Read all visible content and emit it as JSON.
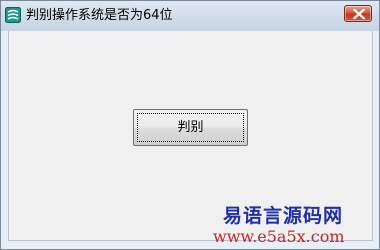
{
  "window": {
    "title": "判别操作系统是否为64位",
    "icon": "app-icon"
  },
  "titlebar": {
    "close_icon": "close-icon",
    "close_color": "#c0392b"
  },
  "main": {
    "button_label": "判别"
  },
  "watermark": {
    "text": "易语言源码网",
    "url": "www.e5a5x.com",
    "text_color": "#1f2fa8",
    "url_color": "#c0282a"
  }
}
